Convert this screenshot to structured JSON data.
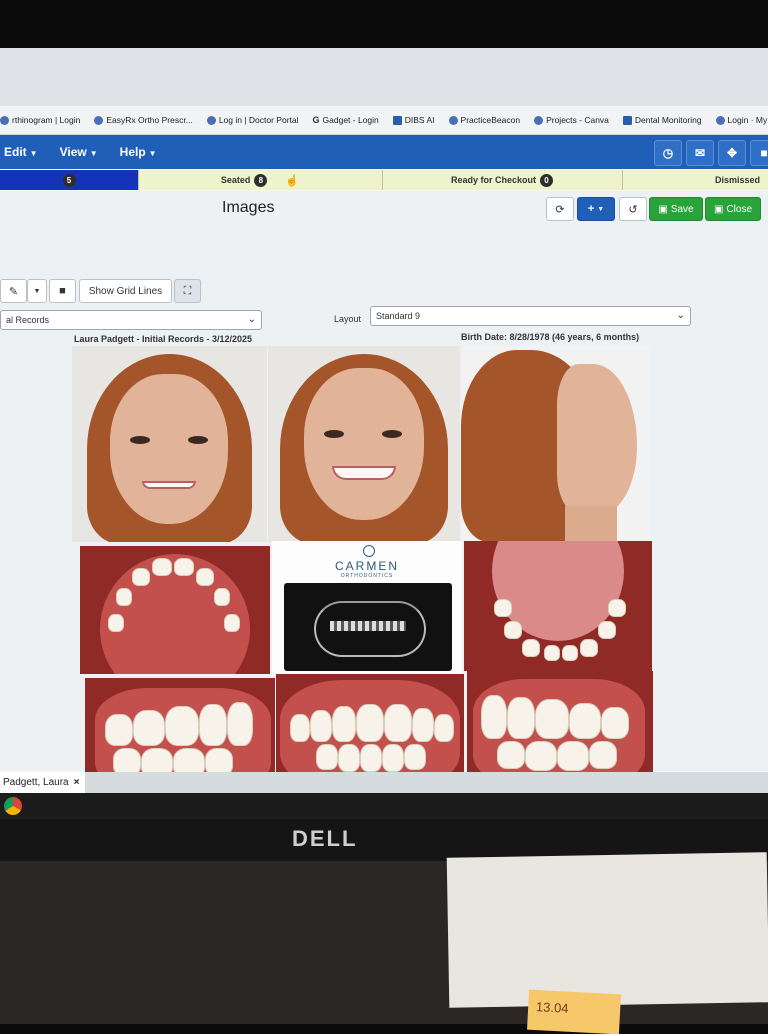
{
  "bookmarks": [
    "rthinogram | Login",
    "EasyRx Ortho Prescr...",
    "Log in | Doctor Portal",
    "Gadget - Login",
    "DIBS AI",
    "PracticeBeacon",
    "Projects - Canva",
    "Dental Monitoring",
    "Login · My iTero"
  ],
  "menu": {
    "edit": "Edit",
    "view": "View",
    "help": "Help"
  },
  "top_icons": [
    "clock-icon",
    "mail-icon",
    "expand-icon",
    "lock-icon"
  ],
  "status": {
    "first_count": "5",
    "seated_label": "Seated",
    "seated_count": "8",
    "checkout_label": "Ready for Checkout",
    "checkout_count": "0",
    "dismissed_label": "Dismissed"
  },
  "page": {
    "title": "Images"
  },
  "toolbar": {
    "show_grid_lines": "Show Grid Lines",
    "save": "Save",
    "close": "Close",
    "add_symbol": "+"
  },
  "records_select": "al Records",
  "layout": {
    "label": "Layout",
    "value": "Standard 9"
  },
  "patient": {
    "header": "Laura Padgett - Initial Records - 3/12/2025",
    "birth": "Birth Date: 8/28/1978 (46 years, 6 months)"
  },
  "logo": {
    "name": "CARMEN",
    "sub": "ORTHODONTICS"
  },
  "tab": {
    "label": "Padgett, Laura",
    "close": "×"
  },
  "monitor_brand": "DELL",
  "sticky_note": "13.04",
  "colors": {
    "menubar": "#1f5fb8",
    "status_bar": "#eef3cc",
    "save": "#2aa43a"
  }
}
